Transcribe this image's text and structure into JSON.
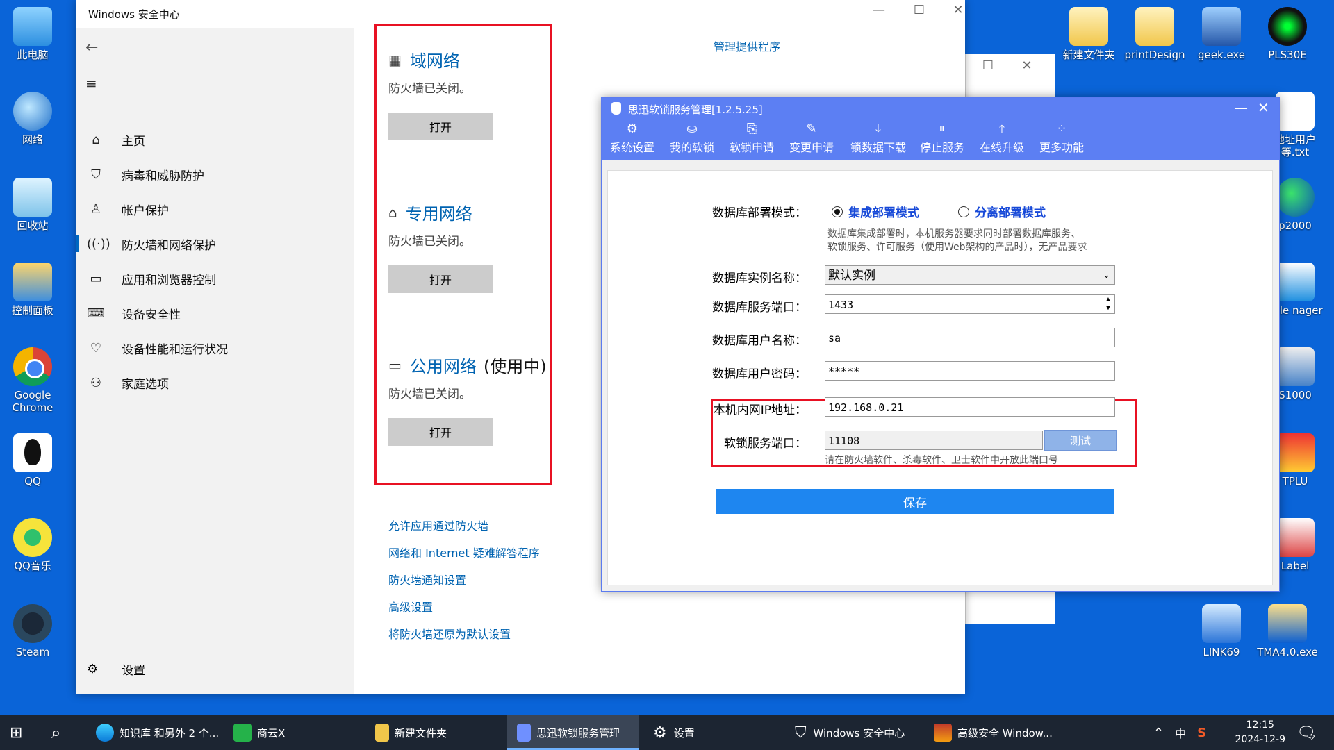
{
  "desktop_left": [
    "此电脑",
    "网络",
    "回收站",
    "控制面板",
    "Google Chrome",
    "QQ",
    "QQ音乐",
    "Steam"
  ],
  "desktop_right_top": [
    "新建文件夹",
    "printDesign",
    "geek.exe",
    "PLS30E"
  ],
  "desktop_right_side": [
    "地址用户等.txt",
    "p2000",
    "cale nager",
    "S1000",
    "TPLU",
    "Label"
  ],
  "desktop_right_bottom": [
    "LINK69",
    "TMA4.0.exe"
  ],
  "security": {
    "title": "Windows 安全中心",
    "nav": [
      {
        "label": "主页",
        "icon": "home-icon"
      },
      {
        "label": "病毒和威胁防护",
        "icon": "shield-icon"
      },
      {
        "label": "帐户保护",
        "icon": "person-icon"
      },
      {
        "label": "防火墙和网络保护",
        "icon": "antenna-icon"
      },
      {
        "label": "应用和浏览器控制",
        "icon": "window-icon"
      },
      {
        "label": "设备安全性",
        "icon": "laptop-icon"
      },
      {
        "label": "设备性能和运行状况",
        "icon": "heart-icon"
      },
      {
        "label": "家庭选项",
        "icon": "family-icon"
      }
    ],
    "settings_label": "设置",
    "manage_providers": "管理提供程序",
    "networks": [
      {
        "name": "域网络",
        "status": "防火墙已关闭。",
        "button": "打开",
        "in_use": ""
      },
      {
        "name": "专用网络",
        "status": "防火墙已关闭。",
        "button": "打开",
        "in_use": ""
      },
      {
        "name": "公用网络",
        "status": "防火墙已关闭。",
        "button": "打开",
        "in_use": "(使用中)"
      }
    ],
    "links": [
      "允许应用通过防火墙",
      "网络和 Internet 疑难解答程序",
      "防火墙通知设置",
      "高级设置",
      "将防火墙还原为默认设置"
    ]
  },
  "softlock": {
    "title": "思迅软锁服务管理[1.2.5.25]",
    "toolbar": [
      "系统设置",
      "我的软锁",
      "软锁申请",
      "变更申请",
      "锁数据下载",
      "停止服务",
      "在线升级",
      "更多功能"
    ],
    "deploy_label": "数据库部署模式：",
    "deploy_options": [
      "集成部署模式",
      "分离部署模式"
    ],
    "deploy_note_1": "数据库集成部署时，本机服务器要求同时部署数据库服务、",
    "deploy_note_2": "软锁服务、许可服务（使用Web架构的产品时），无产品要求",
    "instance_label": "数据库实例名称：",
    "instance_value": "默认实例",
    "port_label": "数据库服务端口：",
    "port_value": "1433",
    "user_label": "数据库用户名称：",
    "user_value": "sa",
    "pwd_label": "数据库用户密码：",
    "pwd_value": "*****",
    "ip_label": "本机内网IP地址：",
    "ip_value": "192.168.0.21",
    "lockport_label": "软锁服务端口：",
    "lockport_value": "11108",
    "test_label": "测试",
    "lockport_note": "请在防火墙软件、杀毒软件、卫士软件中开放此端口号",
    "save_label": "保存"
  },
  "taskbar": {
    "items": [
      "知识库 和另外 2 个...",
      "商云X",
      "新建文件夹",
      "思迅软锁服务管理",
      "设置",
      "Windows 安全中心",
      "高级安全 Window..."
    ],
    "ime": "中",
    "time": "12:15",
    "date": "2024-12-9",
    "notif_count": "2"
  }
}
